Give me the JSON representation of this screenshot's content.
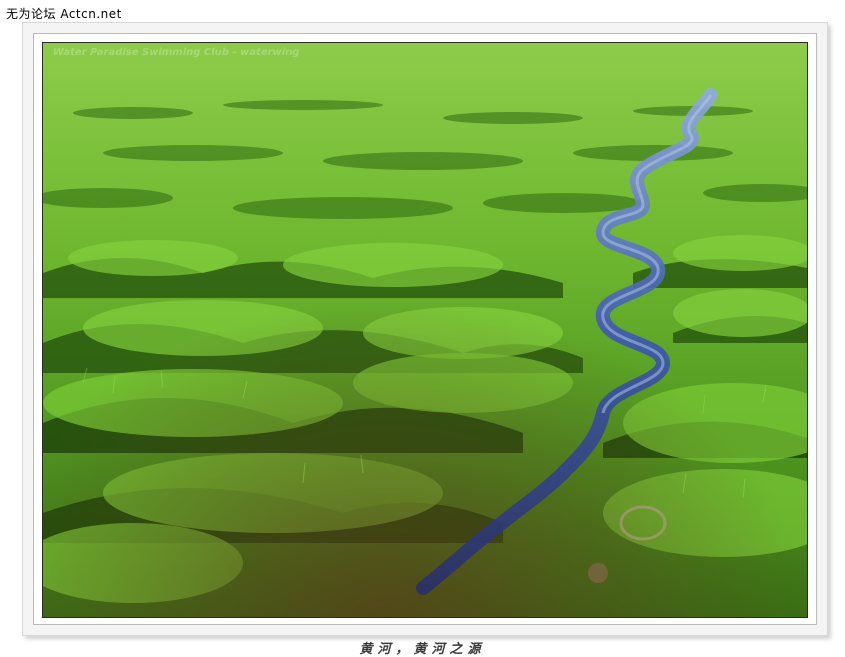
{
  "site_watermark": "无为论坛 Actcn.net",
  "photo": {
    "overlay_watermark": "Water Paradise Swimming Club - waterwing",
    "description_colors": {
      "grass_light": "#7fd13a",
      "grass_mid": "#4e9a1e",
      "grass_dark": "#1f4a0a",
      "stream": "#3a55a8"
    }
  },
  "caption": "黄河，黄河之源"
}
